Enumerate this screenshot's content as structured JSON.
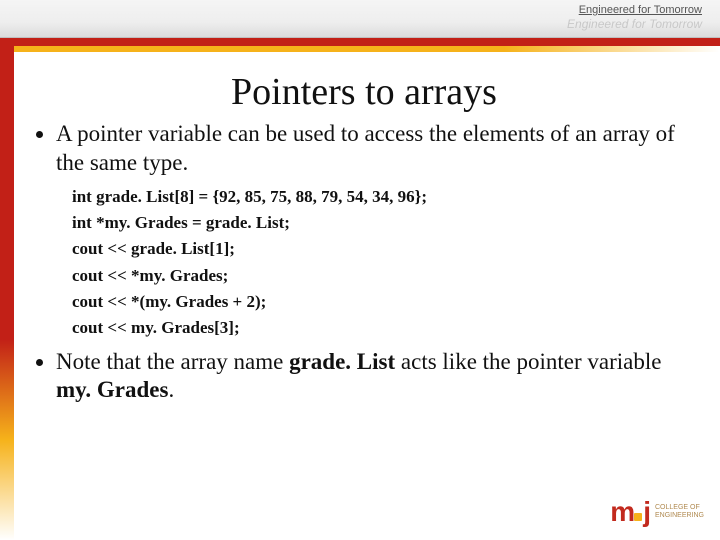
{
  "header": {
    "tagline_top": "Engineered for Tomorrow",
    "tagline_faded": "Engineered for Tomorrow"
  },
  "slide": {
    "title": "Pointers to arrays",
    "bullet1": "A pointer variable can be used to access the elements of an array of the same type.",
    "code": [
      "int grade. List[8] = {92, 85, 75, 88, 79, 54, 34, 96};",
      "int *my. Grades = grade. List;",
      "cout << grade. List[1];",
      "cout << *my. Grades;",
      "cout << *(my. Grades + 2);",
      "cout << my. Grades[3];"
    ],
    "bullet2_pre": "Note that the array name ",
    "bullet2_bold1": "grade. List",
    "bullet2_mid": " acts like the pointer variable ",
    "bullet2_bold2": "my. Grades",
    "bullet2_post": "."
  },
  "footer": {
    "logo_text_line1": "COLLEGE OF",
    "logo_text_line2": "ENGINEERING"
  }
}
